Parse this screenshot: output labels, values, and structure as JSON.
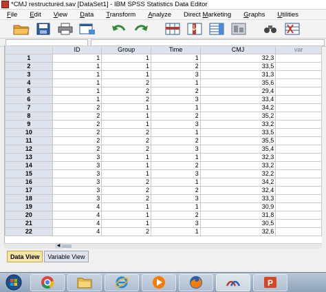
{
  "window": {
    "title": "*CMJ restructured.sav [DataSet1] - IBM SPSS Statistics Data Editor"
  },
  "menu": [
    {
      "underline": "F",
      "rest": "ile"
    },
    {
      "underline": "E",
      "rest": "dit"
    },
    {
      "underline": "V",
      "rest": "iew"
    },
    {
      "underline": "D",
      "rest": "ata"
    },
    {
      "underline": "T",
      "rest": "ransform"
    },
    {
      "underline": "A",
      "rest": "nalyze"
    },
    {
      "pre": "Direct ",
      "underline": "M",
      "rest": "arketing"
    },
    {
      "underline": "G",
      "rest": "raphs"
    },
    {
      "underline": "U",
      "rest": "tilities"
    }
  ],
  "toolbar": {
    "icons": [
      "open-folder-icon",
      "save-icon",
      "print-icon",
      "dialog-recall-icon",
      "undo-icon",
      "redo-icon",
      "goto-case-icon",
      "goto-variable-icon",
      "variables-icon",
      "run-descriptives-icon",
      "find-icon",
      "insert-cases-icon"
    ]
  },
  "grid": {
    "columns": [
      "ID",
      "Group",
      "Time",
      "CMJ",
      "var"
    ],
    "rows": [
      {
        "n": "1",
        "id": "1",
        "group": "1",
        "time": "1",
        "cmj": "32,3"
      },
      {
        "n": "2",
        "id": "1",
        "group": "1",
        "time": "2",
        "cmj": "33,5"
      },
      {
        "n": "3",
        "id": "1",
        "group": "1",
        "time": "3",
        "cmj": "31,3"
      },
      {
        "n": "4",
        "id": "1",
        "group": "2",
        "time": "1",
        "cmj": "35,6"
      },
      {
        "n": "5",
        "id": "1",
        "group": "2",
        "time": "2",
        "cmj": "29,4"
      },
      {
        "n": "6",
        "id": "1",
        "group": "2",
        "time": "3",
        "cmj": "33,4"
      },
      {
        "n": "7",
        "id": "2",
        "group": "1",
        "time": "1",
        "cmj": "34,2"
      },
      {
        "n": "8",
        "id": "2",
        "group": "1",
        "time": "2",
        "cmj": "35,2"
      },
      {
        "n": "9",
        "id": "2",
        "group": "1",
        "time": "3",
        "cmj": "33,2"
      },
      {
        "n": "10",
        "id": "2",
        "group": "2",
        "time": "1",
        "cmj": "33,5"
      },
      {
        "n": "11",
        "id": "2",
        "group": "2",
        "time": "2",
        "cmj": "35,5"
      },
      {
        "n": "12",
        "id": "2",
        "group": "2",
        "time": "3",
        "cmj": "35,4"
      },
      {
        "n": "13",
        "id": "3",
        "group": "1",
        "time": "1",
        "cmj": "32,3"
      },
      {
        "n": "14",
        "id": "3",
        "group": "1",
        "time": "2",
        "cmj": "33,2"
      },
      {
        "n": "15",
        "id": "3",
        "group": "1",
        "time": "3",
        "cmj": "32,2"
      },
      {
        "n": "16",
        "id": "3",
        "group": "2",
        "time": "1",
        "cmj": "34,2"
      },
      {
        "n": "17",
        "id": "3",
        "group": "2",
        "time": "2",
        "cmj": "32,4"
      },
      {
        "n": "18",
        "id": "3",
        "group": "2",
        "time": "3",
        "cmj": "33,3"
      },
      {
        "n": "19",
        "id": "4",
        "group": "1",
        "time": "1",
        "cmj": "30,9"
      },
      {
        "n": "20",
        "id": "4",
        "group": "1",
        "time": "2",
        "cmj": "31,8"
      },
      {
        "n": "21",
        "id": "4",
        "group": "1",
        "time": "3",
        "cmj": "30,5"
      },
      {
        "n": "22",
        "id": "4",
        "group": "2",
        "time": "1",
        "cmj": "32,6"
      }
    ]
  },
  "tabs": {
    "data_view": "Data View",
    "variable_view": "Variable View"
  },
  "taskbar": {
    "items": [
      "start-orb-icon",
      "chrome-icon",
      "file-explorer-icon",
      "internet-explorer-icon",
      "media-player-icon",
      "firefox-icon",
      "spss-icon",
      "powerpoint-icon"
    ]
  }
}
